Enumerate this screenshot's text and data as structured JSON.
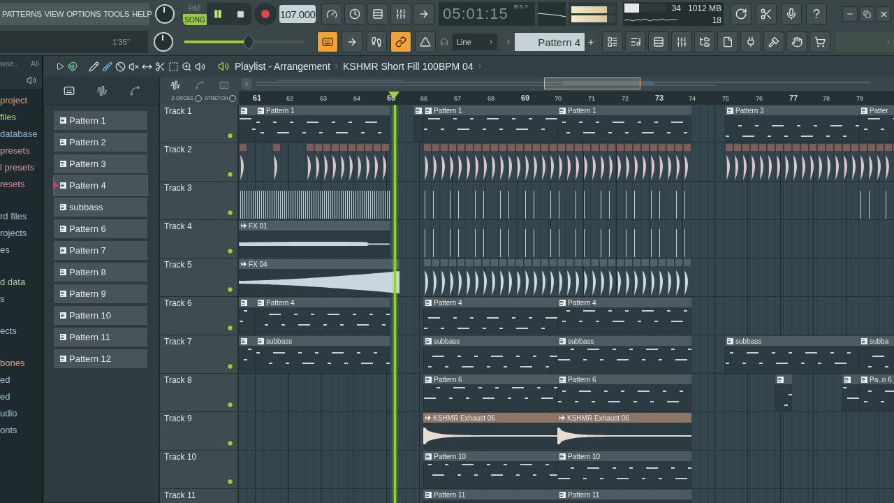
{
  "menu": [
    "PATTERNS",
    "VIEW",
    "OPTIONS",
    "TOOLS",
    "HELP"
  ],
  "hint": "1'35''",
  "transport": {
    "modes": [
      {
        "label": "PAT",
        "selected": false
      },
      {
        "label": "SONG",
        "selected": true
      }
    ],
    "playing": true,
    "tempo": "107.000",
    "time": "05:01:15",
    "time_format": "B:S:T",
    "pitch": {
      "level": 0.54
    }
  },
  "output_meter": [
    {
      "level": 0.82
    },
    {
      "level": 0.82
    }
  ],
  "cpu": {
    "level": 0.35,
    "voices": "34",
    "memory": "1012 MB",
    "polyphony": "18"
  },
  "help": "?",
  "toggles": [
    {
      "kind": "keyboard",
      "on": true
    },
    {
      "kind": "arrow",
      "on": false
    },
    {
      "kind": "step",
      "on": false
    },
    {
      "kind": "link",
      "on": true
    },
    {
      "kind": "metronome",
      "on": false
    }
  ],
  "snap": "Line",
  "pattern_selector": {
    "value": "Pattern 4",
    "add": "+"
  },
  "browser": {
    "header": [
      "wse..",
      "All"
    ],
    "sections": [
      {
        "items": [
          {
            "label": " project",
            "color": "#d9a57c"
          },
          {
            "label": "files",
            "color": "#b9d37a"
          },
          {
            "label": "database",
            "color": "#8fb1d2"
          },
          {
            "label": "presets",
            "color": "#d993ad"
          },
          {
            "label": "l presets",
            "color": "#d993ad"
          },
          {
            "label": "resets",
            "color": "#d993ad"
          }
        ]
      },
      {
        "items": [
          {
            "label": "rd files",
            "color": "#a3c4dc"
          },
          {
            "label": "rojects",
            "color": "#a3c4dc"
          },
          {
            "label": "es",
            "color": "#a3c4dc"
          }
        ]
      },
      {
        "items": [
          {
            "label": "d data",
            "color": "#a6cba2"
          },
          {
            "label": "s",
            "color": "#a3c4dc"
          }
        ]
      },
      {
        "items": [
          {
            "label": "ects",
            "color": "#a3c4dc"
          }
        ]
      },
      {
        "items": [
          {
            "label": "bones",
            "color": "#dba98c"
          },
          {
            "label": "ed",
            "color": "#a3c4dc"
          },
          {
            "label": "ed",
            "color": "#a3c4dc"
          },
          {
            "label": "udio",
            "color": "#a3c4dc"
          },
          {
            "label": "onts",
            "color": "#a3c4dc"
          }
        ]
      }
    ]
  },
  "picker": [
    {
      "label": "Pattern 1",
      "selected": false
    },
    {
      "label": "Pattern 2",
      "selected": false
    },
    {
      "label": "Pattern 3",
      "selected": false
    },
    {
      "label": "Pattern 4",
      "selected": true
    },
    {
      "label": "subbass",
      "selected": false
    },
    {
      "label": "Pattern 6",
      "selected": false
    },
    {
      "label": "Pattern 7",
      "selected": false
    },
    {
      "label": "Pattern 8",
      "selected": false
    },
    {
      "label": "Pattern 9",
      "selected": false
    },
    {
      "label": "Pattern 10",
      "selected": false
    },
    {
      "label": "Pattern 11",
      "selected": false
    },
    {
      "label": "Pattern 12",
      "selected": false
    }
  ],
  "playlist": {
    "title": "Playlist - Arrangement",
    "pattern": "KSHMR Short Fill 100BPM 04",
    "z_cross": {
      "label": "Z-CROSS",
      "checked": false
    },
    "stretch": {
      "label": "STRETCH",
      "checked": false
    },
    "position": {
      "level": 0.237
    },
    "ruler": [
      {
        "label": "61",
        "major": true
      },
      {
        "label": "62",
        "major": false
      },
      {
        "label": "63",
        "major": false
      },
      {
        "label": "64",
        "major": false
      },
      {
        "label": "65",
        "major": true
      },
      {
        "label": "66",
        "major": false
      },
      {
        "label": "67",
        "major": false
      },
      {
        "label": "68",
        "major": false
      },
      {
        "label": "69",
        "major": true
      },
      {
        "label": "70",
        "major": false
      },
      {
        "label": "71",
        "major": false
      },
      {
        "label": "72",
        "major": false
      },
      {
        "label": "73",
        "major": true
      },
      {
        "label": "74",
        "major": false
      },
      {
        "label": "75",
        "major": false
      },
      {
        "label": "76",
        "major": false
      },
      {
        "label": "77",
        "major": true
      },
      {
        "label": "78",
        "major": false
      },
      {
        "label": "79",
        "major": false
      }
    ],
    "tracks": [
      {
        "name": "Track 1",
        "enabled": true,
        "clips": [
          {
            "kind": "pattern"
          },
          {
            "kind": "pattern",
            "label": "Pattern 1"
          },
          {
            "kind": "pattern"
          },
          {
            "kind": "pattern",
            "label": "Pattern 1"
          },
          {
            "kind": "pattern",
            "label": "Pattern 1"
          },
          {
            "kind": "pattern",
            "label": "Pattern 3"
          },
          {
            "kind": "pattern",
            "label": "Patter"
          }
        ]
      },
      {
        "name": "Track 2",
        "enabled": true,
        "clips": [
          {
            "kind": "hits",
            "color": "#7d5d5a"
          },
          {
            "kind": "hits",
            "color": "#7d5d5a"
          },
          {
            "kind": "hits",
            "color": "#7d5d5a"
          }
        ]
      },
      {
        "name": "Track 3",
        "enabled": true,
        "clips": [
          {
            "kind": "ticks"
          },
          {
            "kind": "ticks"
          },
          {
            "kind": "ticks"
          }
        ]
      },
      {
        "name": "Track 4",
        "enabled": true,
        "clips": [
          {
            "kind": "audio",
            "label": "FX 01",
            "color": "#4f5e65"
          },
          {
            "kind": "ticks"
          }
        ]
      },
      {
        "name": "Track 5",
        "enabled": true,
        "clips": [
          {
            "kind": "audio",
            "label": "FX 04",
            "color": "#4f5e65"
          },
          {
            "kind": "hits",
            "color": "#4f6466"
          }
        ]
      },
      {
        "name": "Track 6",
        "enabled": true,
        "clips": [
          {
            "kind": "pattern"
          },
          {
            "kind": "pattern",
            "label": "Pattern 4"
          },
          {
            "kind": "pattern",
            "label": "Pattern 4"
          },
          {
            "kind": "pattern",
            "label": "Pattern 4"
          }
        ]
      },
      {
        "name": "Track 7",
        "enabled": true,
        "clips": [
          {
            "kind": "pattern"
          },
          {
            "kind": "pattern",
            "label": "subbass"
          },
          {
            "kind": "pattern",
            "label": "subbass"
          },
          {
            "kind": "pattern",
            "label": "subbass"
          },
          {
            "kind": "pattern",
            "label": "subbass"
          },
          {
            "kind": "pattern",
            "label": "subba"
          }
        ]
      },
      {
        "name": "Track 8",
        "enabled": true,
        "clips": [
          {
            "kind": "pattern",
            "label": "Pattern 6"
          },
          {
            "kind": "pattern",
            "label": "Pattern 6"
          },
          {
            "kind": "pattern"
          },
          {
            "kind": "pattern"
          },
          {
            "kind": "pattern",
            "label": "Pa..n 6"
          }
        ]
      },
      {
        "name": "Track 9",
        "enabled": true,
        "clips": [
          {
            "kind": "audio",
            "label": "KSHMR Exhaust 06",
            "color": "#8c7565"
          },
          {
            "kind": "audio",
            "label": "KSHMR Exhaust 06",
            "color": "#8c7565"
          }
        ]
      },
      {
        "name": "Track 10",
        "enabled": true,
        "clips": [
          {
            "kind": "pattern",
            "label": "Pattern 10"
          },
          {
            "kind": "pattern",
            "label": "Pattern 10"
          }
        ]
      },
      {
        "name": "Track 11",
        "clips": [
          {
            "kind": "pattern",
            "label": "Pattern 11"
          },
          {
            "kind": "pattern",
            "label": "Pattern 11"
          }
        ]
      }
    ]
  }
}
